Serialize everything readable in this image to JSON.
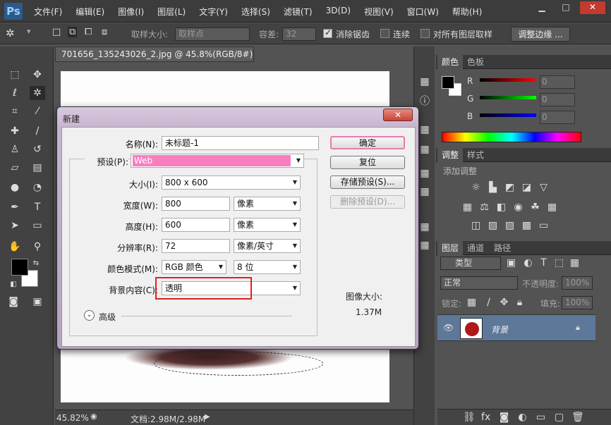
{
  "app": {
    "logo": "Ps"
  },
  "menu": [
    "文件(F)",
    "编辑(E)",
    "图像(I)",
    "图层(L)",
    "文字(Y)",
    "选择(S)",
    "滤镜(T)",
    "3D(D)",
    "视图(V)",
    "窗口(W)",
    "帮助(H)"
  ],
  "window_buttons": {
    "min": "▁",
    "max": "□",
    "close": "✕"
  },
  "options": {
    "sample_size_label": "取样大小:",
    "sample_size_value": "取样点",
    "tolerance_label": "容差:",
    "tolerance_value": "32",
    "antialias_label": "消除锯齿",
    "contiguous_label": "连续",
    "all_layers_label": "对所有图层取样",
    "refine_edge_label": "调整边缘 ..."
  },
  "document": {
    "tab_title": "701656_135243026_2.jpg @ 45.8%(RGB/8#) *",
    "zoom": "45.82%",
    "doc_size": "文档:2.98M/2.98M"
  },
  "color_panel": {
    "tabs": [
      "颜色",
      "色板"
    ],
    "channels": [
      {
        "name": "R",
        "value": "0"
      },
      {
        "name": "G",
        "value": "0"
      },
      {
        "name": "B",
        "value": "0"
      }
    ]
  },
  "adjust_panel": {
    "tabs": [
      "调整",
      "样式"
    ],
    "title": "添加调整"
  },
  "layers_panel": {
    "tabs": [
      "图层",
      "通道",
      "路径"
    ],
    "filter_label": "类型",
    "blend_mode": "正常",
    "opacity_label": "不透明度:",
    "opacity_value": "100%",
    "lock_label": "锁定:",
    "fill_label": "填充:",
    "fill_value": "100%",
    "layer_name": "背景"
  },
  "dialog": {
    "title": "新建",
    "close": "✕",
    "name_label": "名称(N):",
    "name_value": "未标题-1",
    "preset_label": "预设(P):",
    "preset_value": "Web",
    "size_label": "大小(I):",
    "size_value": "800 x 600",
    "width_label": "宽度(W):",
    "width_value": "800",
    "width_unit": "像素",
    "height_label": "高度(H):",
    "height_value": "600",
    "height_unit": "像素",
    "res_label": "分辨率(R):",
    "res_value": "72",
    "res_unit": "像素/英寸",
    "mode_label": "颜色模式(M):",
    "mode_value": "RGB 颜色",
    "bit_value": "8 位",
    "bg_label": "背景内容(C):",
    "bg_value": "透明",
    "advanced_label": "高级",
    "ok": "确定",
    "reset": "复位",
    "save_preset": "存储预设(S)...",
    "delete_preset": "删除预设(D)...",
    "image_size_label": "图像大小:",
    "image_size_value": "1.37M"
  },
  "colors": {
    "accent_pink": "#f77fc0",
    "highlight_red": "#e02020",
    "dialog_title": "#c7b4cf"
  }
}
